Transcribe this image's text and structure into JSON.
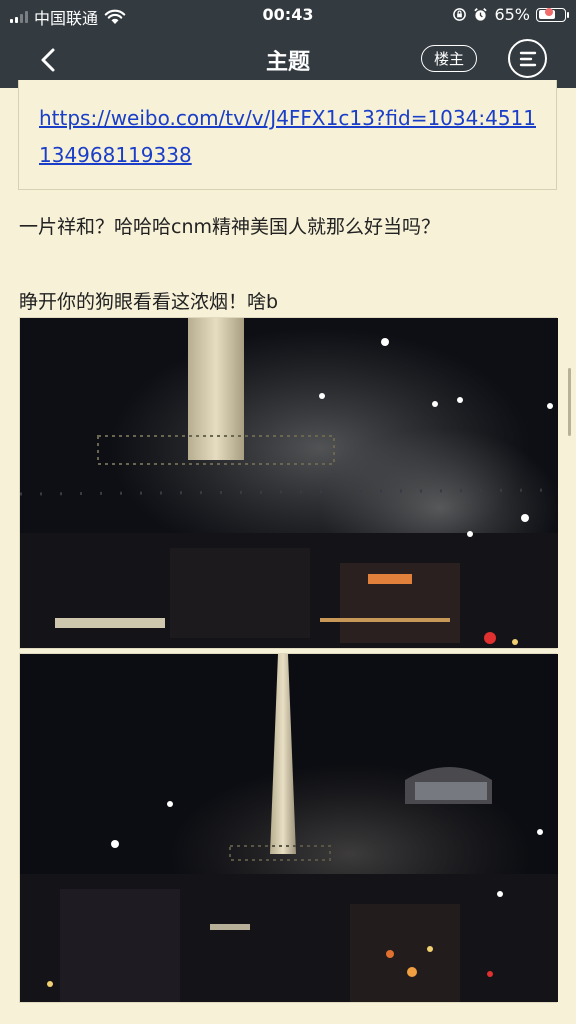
{
  "status_bar": {
    "carrier": "中国联通",
    "time": "00:43",
    "battery": "65%",
    "battery_level": 0.65,
    "icons": [
      "signal-icon",
      "wifi-icon",
      "lock-rotation-icon",
      "alarm-icon",
      "battery-icon"
    ]
  },
  "nav": {
    "title": "主题",
    "owner_label": "楼主",
    "back_icon": "chevron-left-icon",
    "menu_icon": "menu-icon",
    "notify_color": "#f26b6b"
  },
  "post": {
    "link": "https://weibo.com/tv/v/J4FFX1c13?fid=1034:4511134968119338",
    "line1": "一片祥和？哈哈哈cnm精神美国人就那么好当吗？",
    "line2": "睁开你的狗眼看看这浓烟！啥b"
  },
  "colors": {
    "bar_bg": "#333a40",
    "page_bg": "#f6f1d7",
    "link": "#1a3ec8"
  }
}
